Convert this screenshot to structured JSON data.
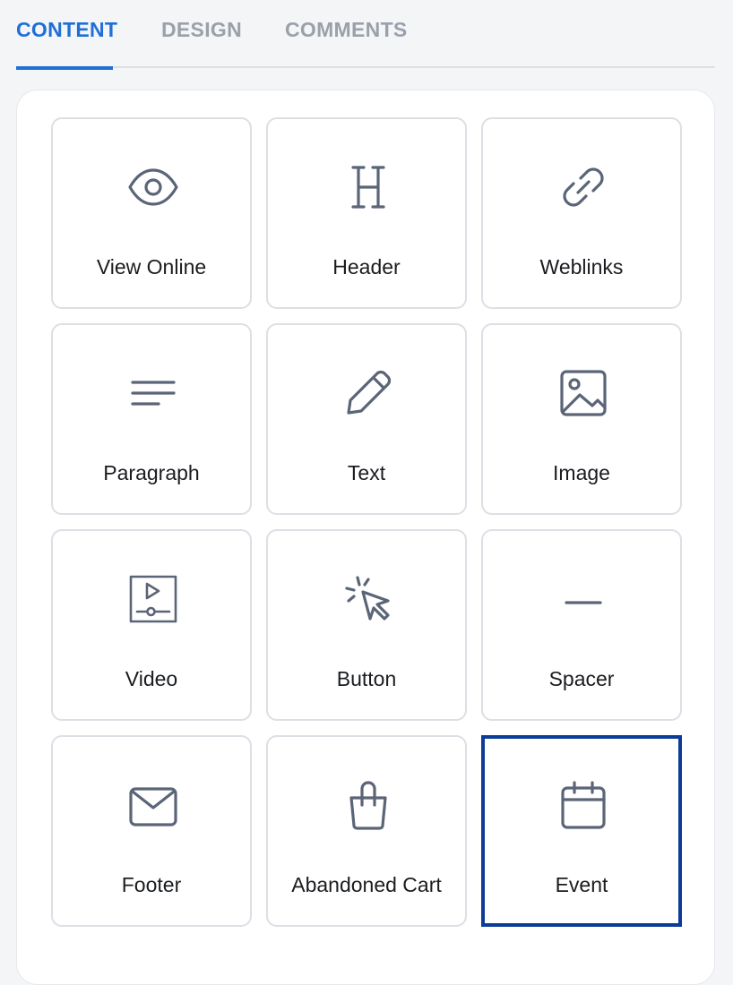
{
  "tabs": [
    {
      "label": "CONTENT",
      "active": true
    },
    {
      "label": "DESIGN",
      "active": false
    },
    {
      "label": "COMMENTS",
      "active": false
    }
  ],
  "blocks": [
    {
      "label": "View Online",
      "icon": "eye-icon"
    },
    {
      "label": "Header",
      "icon": "header-icon"
    },
    {
      "label": "Weblinks",
      "icon": "link-icon"
    },
    {
      "label": "Paragraph",
      "icon": "paragraph-icon"
    },
    {
      "label": "Text",
      "icon": "pencil-icon"
    },
    {
      "label": "Image",
      "icon": "image-icon"
    },
    {
      "label": "Video",
      "icon": "video-icon"
    },
    {
      "label": "Button",
      "icon": "cursor-click-icon"
    },
    {
      "label": "Spacer",
      "icon": "spacer-icon"
    },
    {
      "label": "Footer",
      "icon": "envelope-icon"
    },
    {
      "label": "Abandoned Cart",
      "icon": "shopping-bag-icon"
    },
    {
      "label": "Event",
      "icon": "calendar-icon",
      "selected": true
    }
  ],
  "colors": {
    "accent": "#1f6fd6",
    "selected_border": "#0b3c9a",
    "icon": "#5b6577",
    "inactive_tab": "#9aa1ab"
  }
}
